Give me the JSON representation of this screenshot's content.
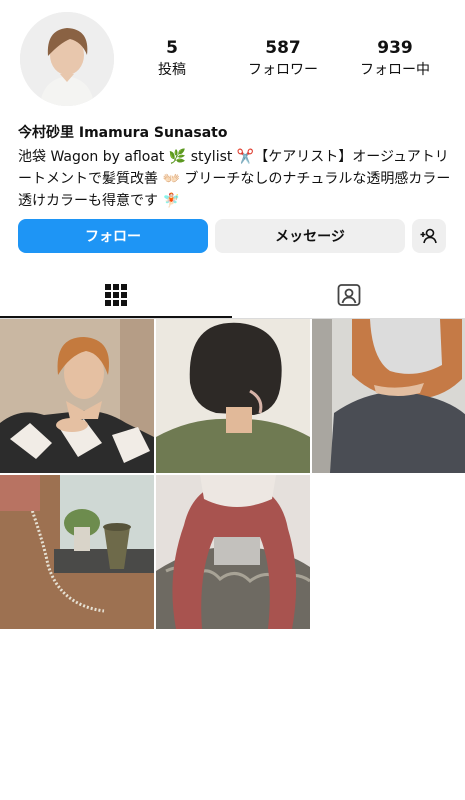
{
  "profile": {
    "name": "今村砂里 Imamura Sunasato",
    "bio": "池袋 Wagon by afloat 🌿 stylist ✂️【ケアリスト】オージュアトリートメントで髪質改善 👐🏻 ブリーチなしのナチュラルな透明感カラー 透けカラーも得意です 🧚🏻",
    "avatar_icon": "profile-photo"
  },
  "stats": {
    "posts": {
      "value": "5",
      "label": "投稿"
    },
    "followers": {
      "value": "587",
      "label": "フォロワー"
    },
    "following": {
      "value": "939",
      "label": "フォロー中"
    }
  },
  "actions": {
    "follow_label": "フォロー",
    "message_label": "メッセージ",
    "add_icon": "add-person-icon"
  },
  "tabs": [
    {
      "name": "grid",
      "icon": "grid-icon",
      "active": true
    },
    {
      "name": "tagged",
      "icon": "tagged-person-icon",
      "active": false
    }
  ],
  "posts": [
    {
      "subject": "woman-orange-bob"
    },
    {
      "subject": "short-dark-bob-back"
    },
    {
      "subject": "orange-hair-mask"
    },
    {
      "subject": "jewelry-display"
    },
    {
      "subject": "pink-wavy-hair-back"
    }
  ],
  "colors": {
    "accent": "#1e95f5",
    "secondary_button": "#efefef",
    "divider": "#dbdbdb"
  }
}
